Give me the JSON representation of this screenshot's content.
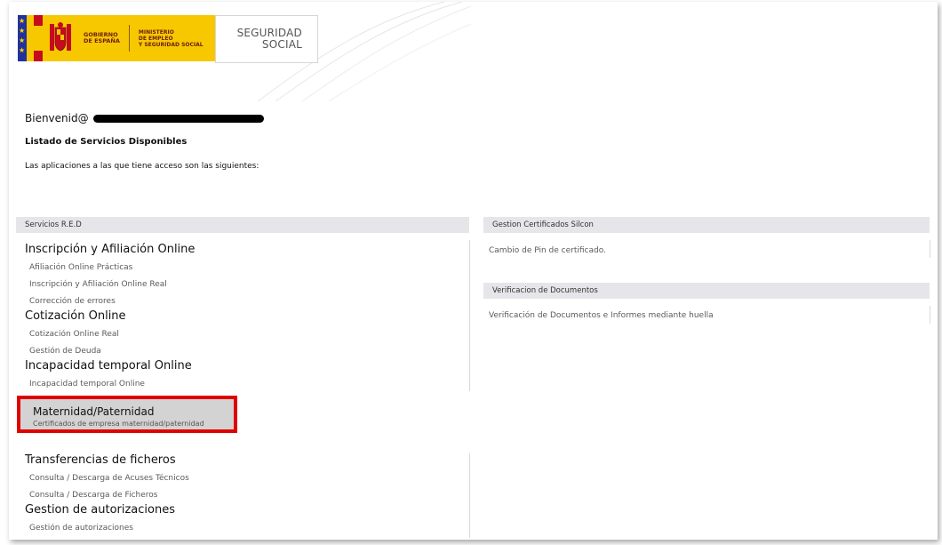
{
  "header": {
    "gov_line1": "GOBIERNO",
    "gov_line2": "DE ESPAÑA",
    "min_line1": "MINISTERIO",
    "min_line2": "DE EMPLEO",
    "min_line3": "Y SEGURIDAD SOCIAL",
    "ss_line1": "SEGURIDAD",
    "ss_line2": "SOCIAL"
  },
  "welcome": {
    "greeting": "Bienvenid@",
    "title": "Listado de Servicios Disponibles",
    "subtitle": "Las aplicaciones a las que tiene acceso son las siguientes:"
  },
  "left": {
    "section_label": "Servicios R.E.D",
    "groups": [
      {
        "title": "Inscripción y Afiliación Online",
        "links": [
          "Afiliación Online Prácticas",
          "Inscripción y Afiliación Online Real",
          "Corrección de errores"
        ]
      },
      {
        "title": "Cotización Online",
        "links": [
          "Cotización Online Real",
          "Gestión de Deuda"
        ]
      },
      {
        "title": "Incapacidad temporal Online",
        "links": [
          "Incapacidad temporal Online"
        ]
      },
      {
        "title": "Maternidad/Paternidad",
        "links": [
          "Certificados de empresa maternidad/paternidad"
        ]
      },
      {
        "title": "Transferencias de ficheros",
        "links": [
          "Consulta / Descarga de Acuses Técnicos",
          "Consulta / Descarga de Ficheros"
        ]
      },
      {
        "title": "Gestion de autorizaciones",
        "links": [
          "Gestión de autorizaciones"
        ]
      }
    ]
  },
  "right": {
    "sections": [
      {
        "label": "Gestion Certificados Silcon",
        "links": [
          "Cambio de Pin de certificado."
        ]
      },
      {
        "label": "Verificacion de Documentos",
        "links": [
          "Verificación de Documentos e Informes mediante huella"
        ]
      }
    ]
  },
  "colors": {
    "highlight_border": "#e00000",
    "section_bar": "#e6e6ea",
    "gov_yellow": "#f7c800"
  }
}
